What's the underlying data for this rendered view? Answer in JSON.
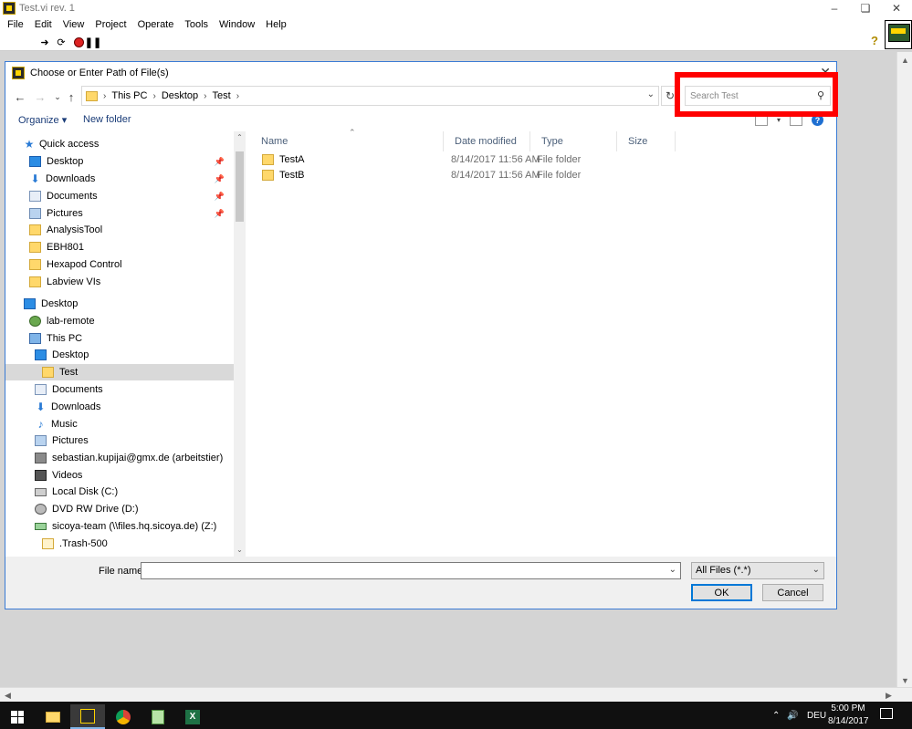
{
  "app": {
    "title": "Test.vi rev. 1",
    "menu": [
      "File",
      "Edit",
      "View",
      "Project",
      "Operate",
      "Tools",
      "Window",
      "Help"
    ]
  },
  "dialog": {
    "title": "Choose or Enter Path of File(s)",
    "breadcrumb": [
      "This PC",
      "Desktop",
      "Test"
    ],
    "search_placeholder": "Search Test",
    "commands": {
      "organize": "Organize",
      "new_folder": "New folder"
    },
    "nav_tree": [
      {
        "label": "Quick access",
        "icon": "star-icon",
        "pinned": false,
        "level": 0
      },
      {
        "label": "Desktop",
        "icon": "desktop-icon",
        "pinned": true,
        "level": 1
      },
      {
        "label": "Downloads",
        "icon": "download-icon",
        "pinned": true,
        "level": 1
      },
      {
        "label": "Documents",
        "icon": "documents-icon",
        "pinned": true,
        "level": 1
      },
      {
        "label": "Pictures",
        "icon": "pictures-icon",
        "pinned": true,
        "level": 1
      },
      {
        "label": "AnalysisTool",
        "icon": "folder-icon",
        "pinned": false,
        "level": 1
      },
      {
        "label": "EBH801",
        "icon": "folder-icon",
        "pinned": false,
        "level": 1
      },
      {
        "label": "Hexapod Control",
        "icon": "folder-icon",
        "pinned": false,
        "level": 1
      },
      {
        "label": "Labview VIs",
        "icon": "folder-icon",
        "pinned": false,
        "level": 1
      },
      {
        "label": "Desktop",
        "icon": "desktop-icon",
        "pinned": false,
        "level": 0
      },
      {
        "label": "lab-remote",
        "icon": "user-icon",
        "pinned": false,
        "level": 1
      },
      {
        "label": "This PC",
        "icon": "computer-icon",
        "pinned": false,
        "level": 1
      },
      {
        "label": "Desktop",
        "icon": "desktop-icon",
        "pinned": false,
        "level": 2
      },
      {
        "label": "Test",
        "icon": "folder-icon",
        "pinned": false,
        "level": 3,
        "selected": true
      },
      {
        "label": "Documents",
        "icon": "documents-icon",
        "pinned": false,
        "level": 2
      },
      {
        "label": "Downloads",
        "icon": "download-icon",
        "pinned": false,
        "level": 2
      },
      {
        "label": "Music",
        "icon": "music-icon",
        "pinned": false,
        "level": 2
      },
      {
        "label": "Pictures",
        "icon": "pictures-icon",
        "pinned": false,
        "level": 2
      },
      {
        "label": "sebastian.kupijai@gmx.de (arbeitstier)",
        "icon": "contact-icon",
        "pinned": false,
        "level": 2
      },
      {
        "label": "Videos",
        "icon": "videos-icon",
        "pinned": false,
        "level": 2
      },
      {
        "label": "Local Disk (C:)",
        "icon": "disk-icon",
        "pinned": false,
        "level": 2
      },
      {
        "label": "DVD RW Drive (D:)",
        "icon": "dvd-icon",
        "pinned": false,
        "level": 2
      },
      {
        "label": "sicoya-team (\\\\files.hq.sicoya.de) (Z:)",
        "icon": "network-drive-icon",
        "pinned": false,
        "level": 2
      },
      {
        "label": ".Trash-500",
        "icon": "folder-icon",
        "pinned": false,
        "level": 3
      }
    ],
    "columns": {
      "name": "Name",
      "date": "Date modified",
      "type": "Type",
      "size": "Size"
    },
    "files": [
      {
        "name": "TestA",
        "date": "8/14/2017 11:56 AM",
        "type": "File folder"
      },
      {
        "name": "TestB",
        "date": "8/14/2017 11:56 AM",
        "type": "File folder"
      }
    ],
    "file_name_label": "File name:",
    "file_name_value": "",
    "filter": "All Files (*.*)",
    "ok": "OK",
    "cancel": "Cancel"
  },
  "taskbar": {
    "language": "DEU",
    "time": "5:00 PM",
    "date": "8/14/2017"
  }
}
